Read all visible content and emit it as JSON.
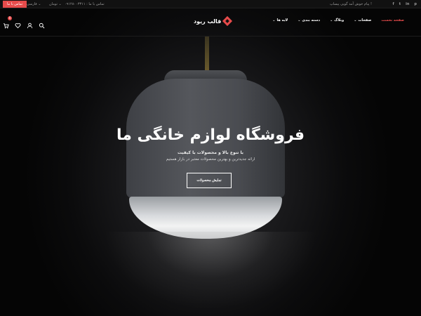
{
  "topbar": {
    "contact_label": "تماس با ما",
    "language": "فارسی ⌄",
    "currency": "تومان ⌄",
    "phone": "تماس با ما : ۰۹۱۲۸۰۰۳۳۱۱",
    "promo": "پیام خوش آمد گویی پیساپ !",
    "socials": [
      "f",
      "t",
      "in",
      "p"
    ]
  },
  "header": {
    "logo_text": "قالب ریود",
    "cart_count": "0",
    "nav": [
      {
        "label": "صفحه نخست",
        "active": true
      },
      {
        "label": "صفحات",
        "has_menu": true
      },
      {
        "label": "وبلاگ",
        "has_menu": true
      },
      {
        "label": "دسته بندی",
        "has_menu": true
      },
      {
        "label": "لایه ها",
        "has_menu": true
      }
    ],
    "icons": [
      "cart-icon",
      "heart-icon",
      "user-icon",
      "search-icon"
    ]
  },
  "hero": {
    "title": "فروشگاه لوازم خانگی ما",
    "subtitle_1": "با تنوع بالا و محصولات با کیفیت",
    "subtitle_2": "ارائه جدیدترین و بهترین محصولات معتبر در بازار هستیم",
    "cta_label": "نمایش محصولات"
  },
  "colors": {
    "accent": "#e64b4b",
    "background": "#0b0b0c",
    "text": "#ffffff"
  }
}
